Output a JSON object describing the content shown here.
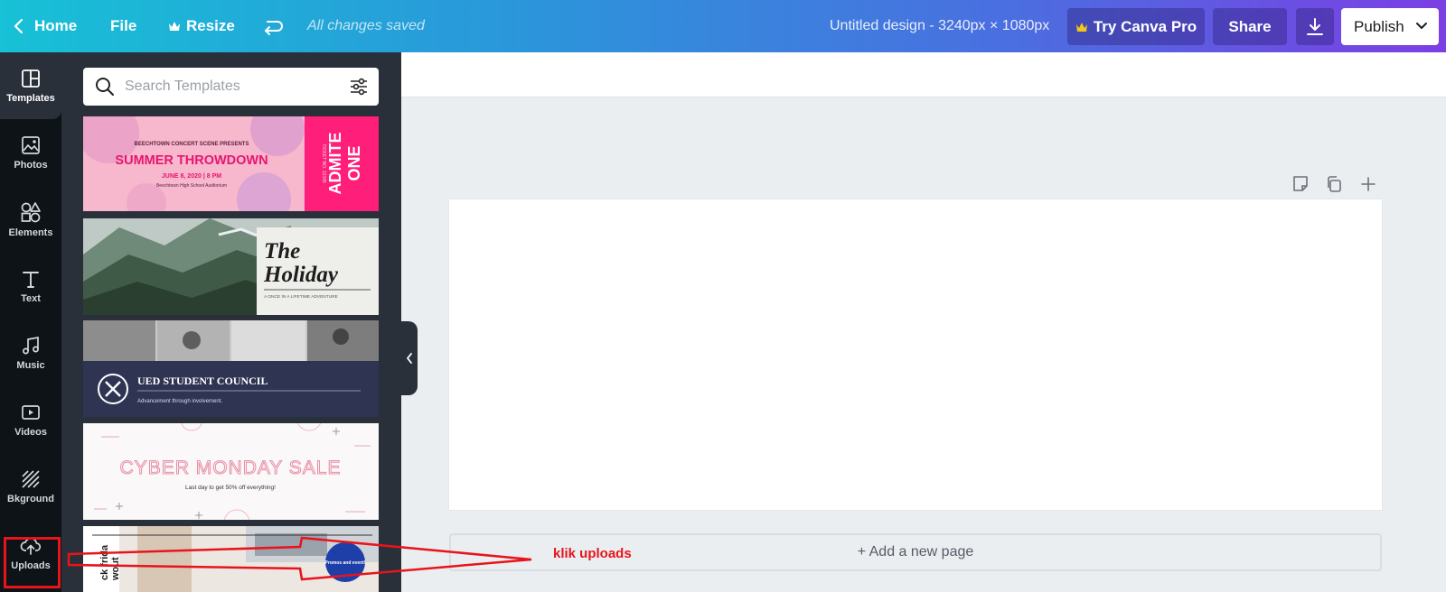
{
  "topbar": {
    "home": "Home",
    "file": "File",
    "resize": "Resize",
    "saved_status": "All changes saved",
    "design_title": "Untitled design - 3240px × 1080px",
    "try_pro": "Try Canva Pro",
    "share": "Share",
    "publish": "Publish"
  },
  "rail": {
    "items": [
      {
        "label": "Templates",
        "icon": "templates-icon"
      },
      {
        "label": "Photos",
        "icon": "photos-icon"
      },
      {
        "label": "Elements",
        "icon": "elements-icon"
      },
      {
        "label": "Text",
        "icon": "text-icon"
      },
      {
        "label": "Music",
        "icon": "music-icon"
      },
      {
        "label": "Videos",
        "icon": "videos-icon"
      },
      {
        "label": "Bkground",
        "icon": "background-icon"
      },
      {
        "label": "Uploads",
        "icon": "upload-icon"
      }
    ]
  },
  "search": {
    "placeholder": "Search Templates"
  },
  "templates": {
    "t1": {
      "presents": "BEECHTOWN CONCERT SCENE PRESENTS",
      "title": "SUMMER THROWDOWN",
      "date": "JUNE 8, 2020 | 8 PM",
      "venue": "Beechtown High School Auditorium",
      "ticket_no": "TICKET NO. 12345",
      "admit_1": "ADMITE",
      "admit_2": "ONE"
    },
    "t2": {
      "line1": "The",
      "line2": "Holiday",
      "tagline": "A ONCE IN A LIFETIME ADVENTURE"
    },
    "t3": {
      "title": "UED STUDENT COUNCIL",
      "subtitle": "Advancement through involvement."
    },
    "t4": {
      "title": "CYBER MONDAY SALE",
      "subtitle": "Last day to get 50% off everything!"
    },
    "t5": {
      "side_1": "ck frida",
      "side_2": "wout",
      "badge": "Promos and event!"
    }
  },
  "canvas": {
    "add_page": "+ Add a new page"
  },
  "annotation": {
    "text": "klik uploads"
  },
  "colors": {
    "accent_red": "#e8141b",
    "rail_bg": "#0e1318",
    "panel_bg": "#293039",
    "gradient_start": "#17c1d6",
    "gradient_end": "#7b3fe4"
  }
}
